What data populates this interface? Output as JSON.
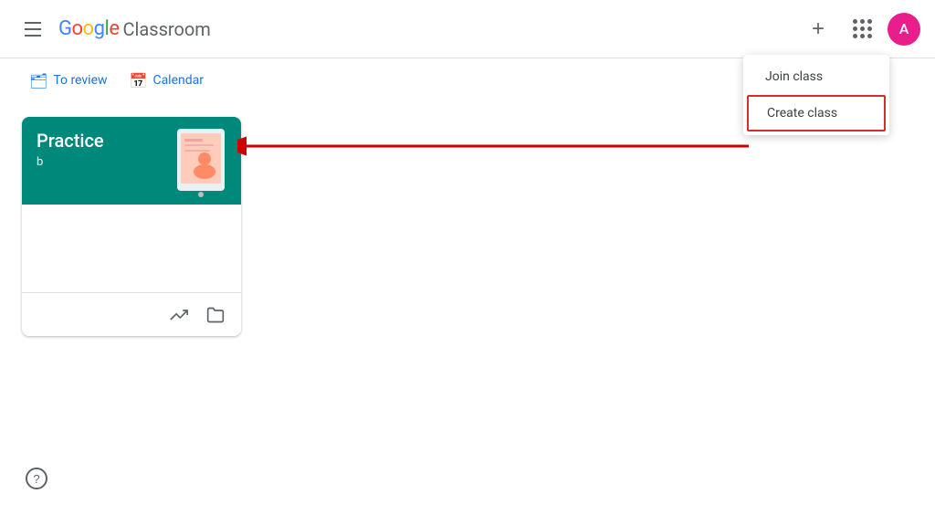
{
  "header": {
    "menu_label": "Main menu",
    "logo_google": "Google",
    "logo_classroom": "Classroom",
    "add_button_label": "+",
    "grid_button_label": "Google apps",
    "avatar_initial": "A"
  },
  "subnav": {
    "review_label": "To review",
    "calendar_label": "Calendar"
  },
  "dropdown": {
    "join_class_label": "Join class",
    "create_class_label": "Create class"
  },
  "class_card": {
    "title": "Practice",
    "subtitle": "b",
    "bg_color": "#00897b"
  },
  "footer": {
    "help_label": "?"
  }
}
